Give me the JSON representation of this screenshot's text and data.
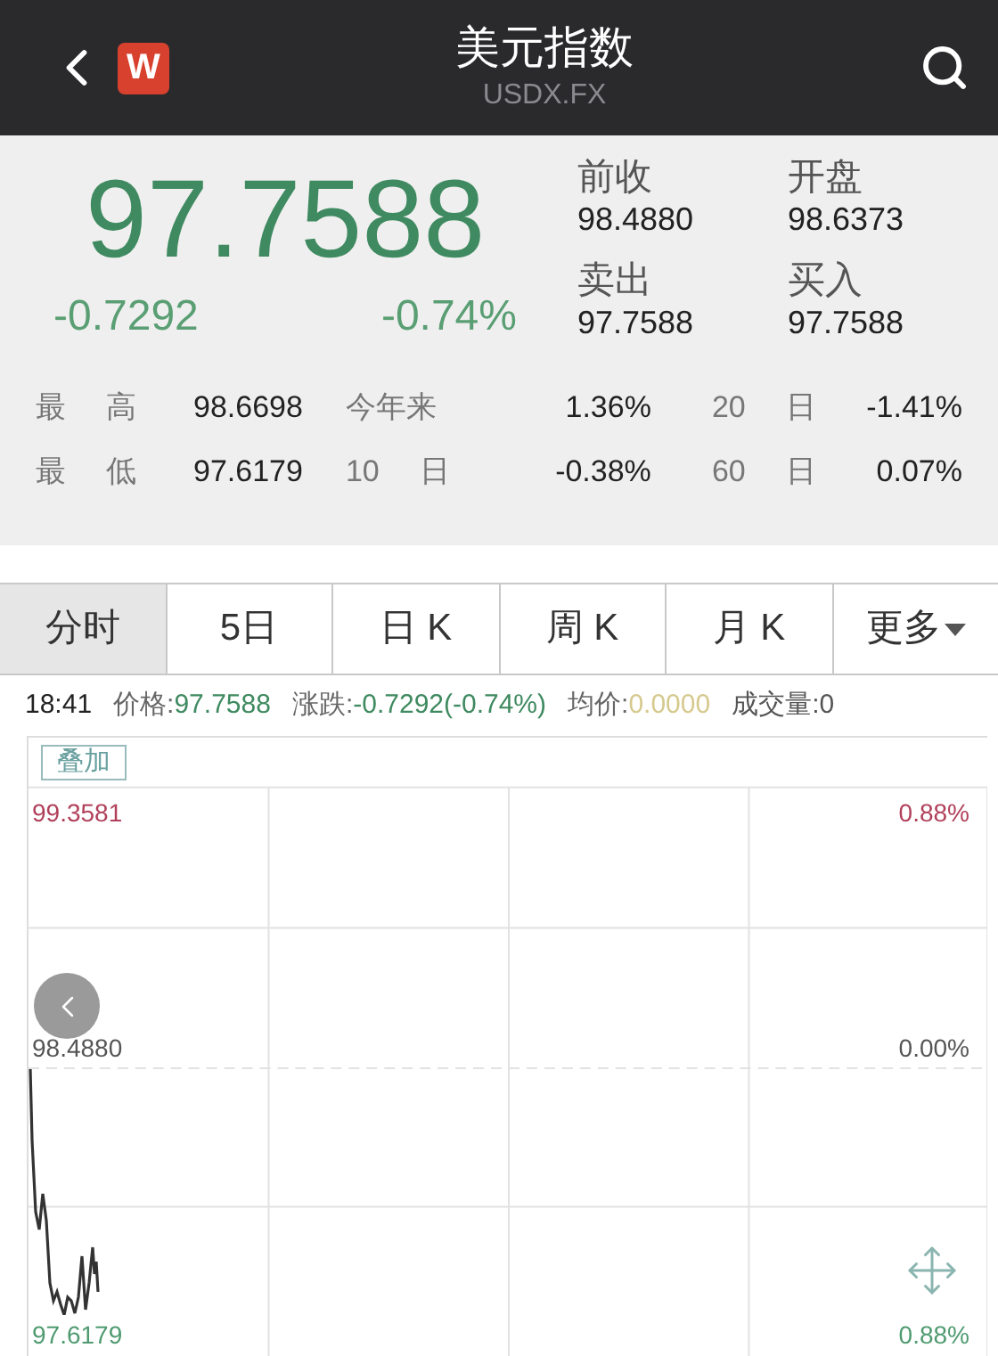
{
  "header": {
    "title": "美元指数",
    "subtitle": "USDX.FX",
    "logo": "W"
  },
  "quote": {
    "price": "97.7588",
    "change": "-0.7292",
    "change_pct": "-0.74%",
    "stats": [
      {
        "label": "前收",
        "value": "98.4880"
      },
      {
        "label": "开盘",
        "value": "98.6373"
      },
      {
        "label": "卖出",
        "value": "97.7588"
      },
      {
        "label": "买入",
        "value": "97.7588"
      }
    ],
    "ranges": [
      [
        {
          "label": "最 高",
          "value": "98.6698"
        },
        {
          "label": "今年来",
          "value": "1.36%"
        },
        {
          "label": "20 日",
          "value": "-1.41%"
        }
      ],
      [
        {
          "label": "最 低",
          "value": "97.6179"
        },
        {
          "label": "10 日",
          "value": "-0.38%"
        },
        {
          "label": "60 日",
          "value": "0.07%"
        }
      ]
    ]
  },
  "tabs": [
    {
      "label": "分时",
      "selected": true
    },
    {
      "label": "5日",
      "selected": false
    },
    {
      "label": "日 K",
      "selected": false
    },
    {
      "label": "周 K",
      "selected": false
    },
    {
      "label": "月 K",
      "selected": false
    },
    {
      "label": "更多",
      "selected": false,
      "dropdown": true
    }
  ],
  "info": [
    {
      "text": "18:41"
    },
    {
      "label": "价格:",
      "value": "97.7588",
      "color": "#3f8a60"
    },
    {
      "label": "涨跌:",
      "value": "-0.7292(-0.74%)",
      "color": "#3f8a60"
    },
    {
      "label": "均价:",
      "value": "0.0000",
      "color": "#d6c98e"
    },
    {
      "text": "成交量:0"
    }
  ],
  "chart": {
    "overlay_button": "叠加",
    "axis": [
      {
        "price": "99.3581",
        "pct": "0.88%",
        "color": "#b0405a"
      },
      {
        "price": "98.4880",
        "pct": "0.00%",
        "color": "#555555"
      },
      {
        "price": "97.6179",
        "pct": "0.88%",
        "color": "#4f9a70"
      }
    ]
  }
}
